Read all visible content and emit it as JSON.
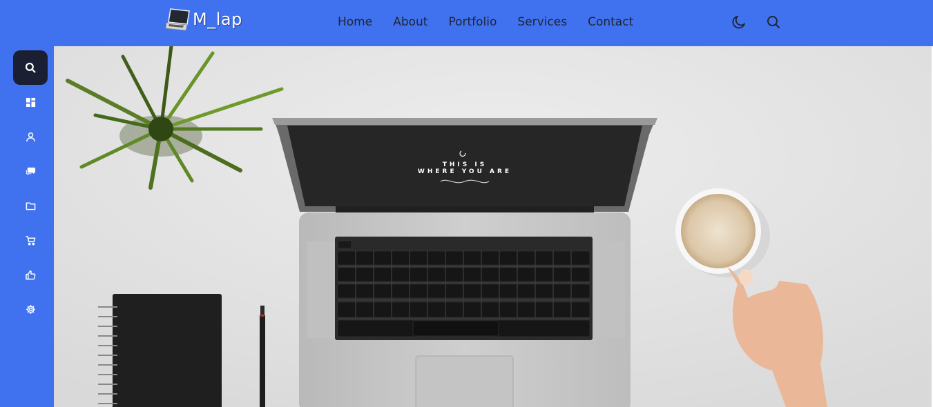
{
  "brand": {
    "logo_text": "M_lap",
    "logo_icon": "laptop-logo-icon"
  },
  "nav": {
    "items": [
      "Home",
      "About",
      "Portfolio",
      "Services",
      "Contact"
    ]
  },
  "header_icons": {
    "theme_toggle": "moon-icon",
    "search": "search-icon"
  },
  "sidebar": {
    "items": [
      {
        "icon": "search-icon",
        "active": true
      },
      {
        "icon": "dashboard-icon"
      },
      {
        "icon": "user-icon"
      },
      {
        "icon": "chat-icon"
      },
      {
        "icon": "folder-icon"
      },
      {
        "icon": "cart-icon"
      },
      {
        "icon": "thumbs-up-icon"
      },
      {
        "icon": "gear-icon"
      }
    ]
  },
  "hero": {
    "screen_text_line1": "THIS IS",
    "screen_text_line2": "WHERE YOU ARE"
  },
  "colors": {
    "primary": "#4072f0",
    "active_bg": "#1b1f33",
    "nav_text": "#1f2430",
    "hero_bg": "#e6e6e6"
  }
}
